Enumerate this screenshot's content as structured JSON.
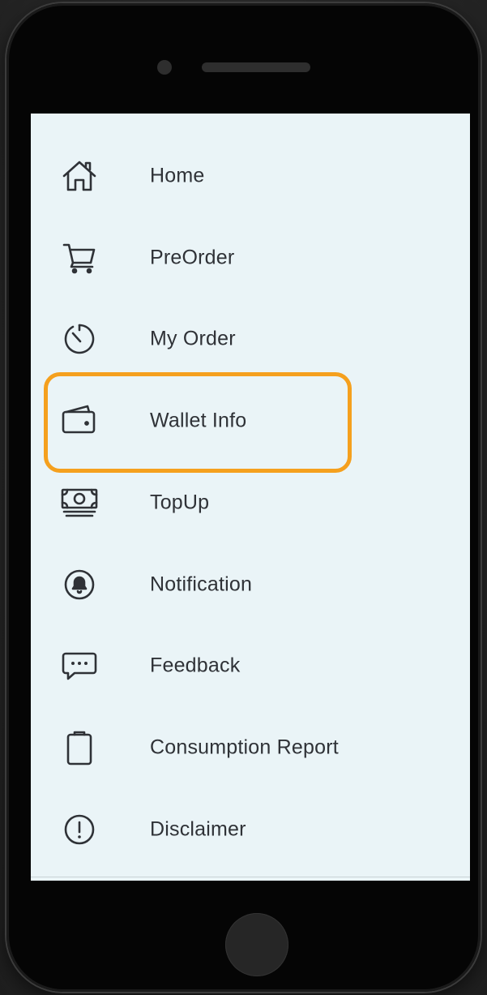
{
  "menu": {
    "items": [
      {
        "label": "Home",
        "icon": "home-icon"
      },
      {
        "label": "PreOrder",
        "icon": "cart-icon"
      },
      {
        "label": "My Order",
        "icon": "timer-icon"
      },
      {
        "label": "Wallet Info",
        "icon": "wallet-icon"
      },
      {
        "label": "TopUp",
        "icon": "money-icon"
      },
      {
        "label": "Notification",
        "icon": "bell-icon"
      },
      {
        "label": "Feedback",
        "icon": "chat-icon"
      },
      {
        "label": "Consumption Report",
        "icon": "clipboard-icon"
      },
      {
        "label": "Disclaimer",
        "icon": "alert-icon"
      }
    ],
    "highlighted": "Wallet Info"
  },
  "colors": {
    "screen_background": "#eaf4f7",
    "text": "#2f3237",
    "highlight": "#f5a01e",
    "phone_body": "#050505"
  }
}
